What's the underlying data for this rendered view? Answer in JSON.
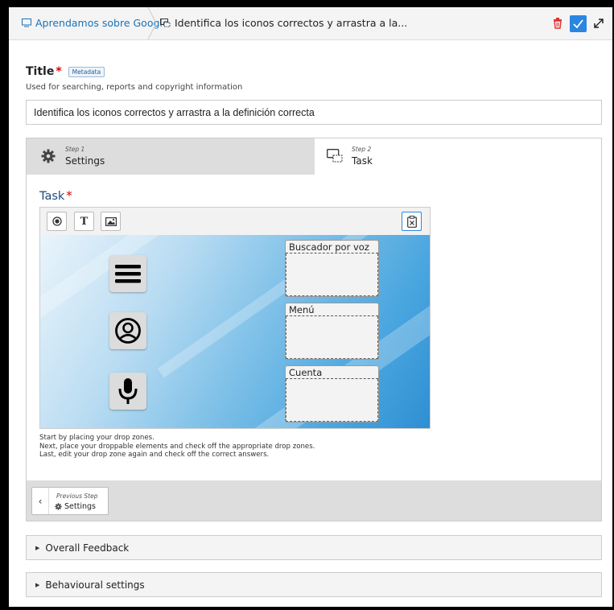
{
  "topbar": {
    "breadcrumb_1": "Aprendamos sobre Google",
    "breadcrumb_2": "Identifica los iconos correctos y arrastra a la..."
  },
  "title_field": {
    "label": "Title",
    "required_mark": "*",
    "badge": "Metadata",
    "help": "Used for searching, reports and copyright information",
    "value": "Identifica los iconos correctos y arrastra a la definición correcta"
  },
  "wizard": {
    "steps": [
      {
        "step": "Step 1",
        "name": "Settings",
        "active": false
      },
      {
        "step": "Step 2",
        "name": "Task",
        "active": true
      }
    ],
    "task_label": "Task",
    "task_required": "*",
    "drop_zones": [
      {
        "label": "Buscador por voz"
      },
      {
        "label": "Menú"
      },
      {
        "label": "Cuenta"
      }
    ],
    "draggables": [
      {
        "icon": "menu-icon"
      },
      {
        "icon": "account-icon"
      },
      {
        "icon": "microphone-icon"
      }
    ],
    "help_lines": [
      "Start by placing your drop zones.",
      "Next, place your droppable elements and check off the appropriate drop zones.",
      "Last, edit your drop zone again and check off the correct answers."
    ],
    "previous": {
      "step": "Previous Step",
      "name": "Settings"
    }
  },
  "accordions": [
    {
      "label": "Overall Feedback"
    },
    {
      "label": "Behavioural settings"
    }
  ],
  "colors": {
    "accent": "#2b86e0",
    "required": "#dd0000",
    "link": "#1a73b8"
  }
}
